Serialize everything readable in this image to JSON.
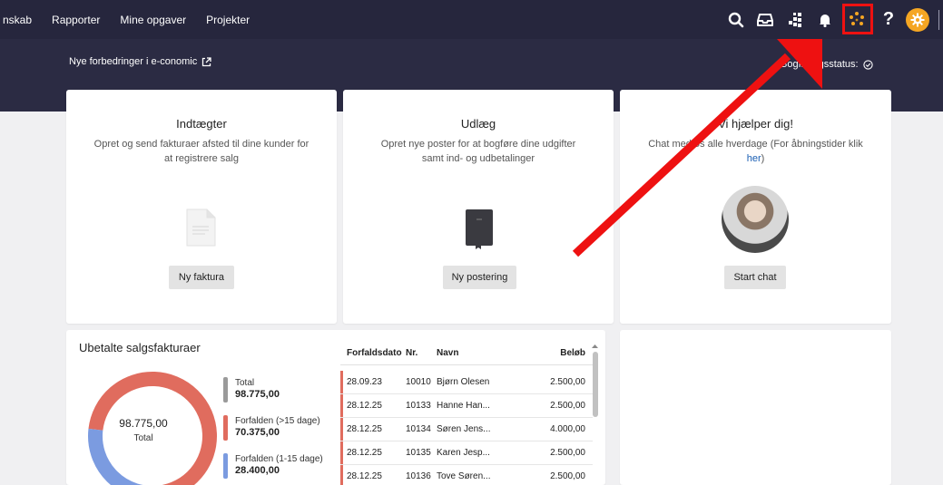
{
  "nav": {
    "items": [
      "nskab",
      "Rapporter",
      "Mine opgaver",
      "Projekter"
    ],
    "icons": [
      "search-icon",
      "inbox-icon",
      "apps-grid-icon",
      "bell-icon",
      "dots-loader-icon",
      "help-icon",
      "settings-gear-icon"
    ]
  },
  "banner": {
    "news_text": "Nye forbedringer i e-conomic",
    "status_text": "Bogføringsstatus:",
    "status_visible_prefix": "Bo",
    "status_visible_suffix": "status:"
  },
  "cards": {
    "income": {
      "title": "Indtægter",
      "desc": "Opret og send fakturaer afsted til dine kunder for at registrere salg",
      "button": "Ny faktura"
    },
    "expenses": {
      "title": "Udlæg",
      "desc": "Opret nye poster for at bogføre dine udgifter samt ind- og udbetalinger",
      "button": "Ny postering"
    },
    "help": {
      "title": "Vi hjælper dig!",
      "desc_prefix": "Chat med os alle hverdage (For åbningstider klik ",
      "desc_link": "her",
      "desc_suffix": ")",
      "button": "Start chat"
    }
  },
  "unpaid": {
    "title": "Ubetalte salgsfakturaer",
    "donut_total_value": "98.775,00",
    "donut_total_label": "Total",
    "legend": [
      {
        "label": "Total",
        "value": "98.775,00",
        "color": "#9a9a9a"
      },
      {
        "label": "Forfalden (>15 dage)",
        "value": "70.375,00",
        "color": "#e06c5e"
      },
      {
        "label": "Forfalden (1-15 dage)",
        "value": "28.400,00",
        "color": "#7b9be0"
      }
    ],
    "segments": [
      {
        "name": "Forfalden (>15 dage)",
        "value": 70375,
        "color": "#e06c5e"
      },
      {
        "name": "Forfalden (1-15 dage)",
        "value": 28400,
        "color": "#7b9be0"
      }
    ]
  },
  "table": {
    "headers": {
      "due": "Forfaldsdato",
      "no": "Nr.",
      "name": "Navn",
      "amount": "Beløb"
    },
    "rows": [
      {
        "due": "28.09.23",
        "no": "10010",
        "name": "Bjørn Olesen",
        "amount": "2.500,00"
      },
      {
        "due": "28.12.25",
        "no": "10133",
        "name": "Hanne Han...",
        "amount": "2.500,00"
      },
      {
        "due": "28.12.25",
        "no": "10134",
        "name": "Søren Jens...",
        "amount": "4.000,00"
      },
      {
        "due": "28.12.25",
        "no": "10135",
        "name": "Karen Jesp...",
        "amount": "2.500,00"
      },
      {
        "due": "28.12.25",
        "no": "10136",
        "name": "Tove Søren...",
        "amount": "2.500,00"
      }
    ]
  },
  "colors": {
    "nav_bg": "#26263d",
    "banner_bg": "#2b2b43",
    "accent_orange": "#f5a623",
    "annotation_red": "#ee1111"
  }
}
